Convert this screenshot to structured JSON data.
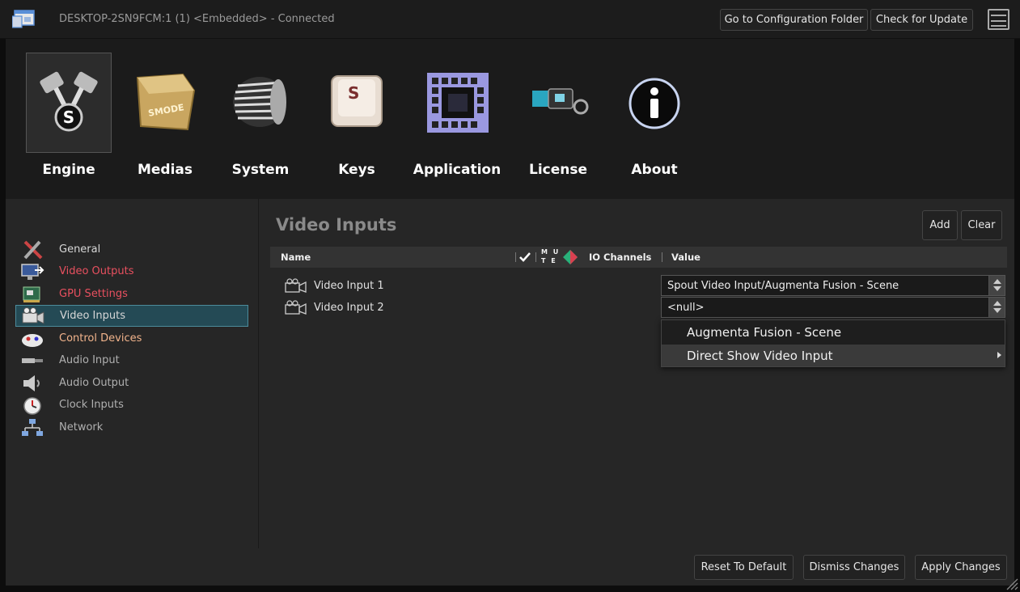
{
  "window": {
    "title": "DESKTOP-2SN9FCM:1 (1) <Embedded> - Connected",
    "go_to_config_label": "Go to Configuration Folder",
    "check_update_label": "Check for Update"
  },
  "categories": [
    {
      "label": "Engine",
      "icon": "engine-pistons-icon",
      "selected": true
    },
    {
      "label": "Medias",
      "icon": "medias-icon"
    },
    {
      "label": "System",
      "icon": "system-heatsink-icon"
    },
    {
      "label": "Keys",
      "icon": "keys-keycap-icon"
    },
    {
      "label": "Application",
      "icon": "application-chip-icon"
    },
    {
      "label": "License",
      "icon": "license-usb-key-icon"
    },
    {
      "label": "About",
      "icon": "about-info-icon"
    }
  ],
  "sidebar": {
    "items": [
      {
        "label": "General",
        "icon": "tools-icon",
        "color": "#d7d7d7"
      },
      {
        "label": "Video Outputs",
        "icon": "monitor-arrow-icon",
        "color": "#e8505f"
      },
      {
        "label": "GPU Settings",
        "icon": "gpu-board-icon",
        "color": "#e8505f"
      },
      {
        "label": "Video Inputs",
        "icon": "camera-icon",
        "color": "#d7d7d7",
        "selected": true
      },
      {
        "label": "Control Devices",
        "icon": "control-device-icon",
        "color": "#f2b48c"
      },
      {
        "label": "Audio Input",
        "icon": "audio-jack-icon",
        "color": "#b0b0b0"
      },
      {
        "label": "Audio Output",
        "icon": "speaker-icon",
        "color": "#b0b0b0"
      },
      {
        "label": "Clock Inputs",
        "icon": "clock-icon",
        "color": "#b0b0b0"
      },
      {
        "label": "Network",
        "icon": "network-icon",
        "color": "#b0b0b0"
      }
    ]
  },
  "panel": {
    "title": "Video Inputs",
    "add_label": "Add",
    "clear_label": "Clear",
    "columns": {
      "name": "Name",
      "mute_top": "M U",
      "mute_bottom": "T E",
      "io_channels": "IO Channels",
      "value": "Value"
    },
    "rows": [
      {
        "name": "Video Input 1",
        "value": "Spout Video Input/Augmenta Fusion - Scene"
      },
      {
        "name": "Video Input 2",
        "value": "<null>"
      }
    ],
    "dropdown": {
      "items": [
        {
          "label": "Augmenta Fusion - Scene"
        },
        {
          "label": "Direct Show Video Input",
          "has_submenu": true
        }
      ]
    }
  },
  "footer": {
    "reset_label": "Reset To Default",
    "dismiss_label": "Dismiss Changes",
    "apply_label": "Apply Changes"
  }
}
